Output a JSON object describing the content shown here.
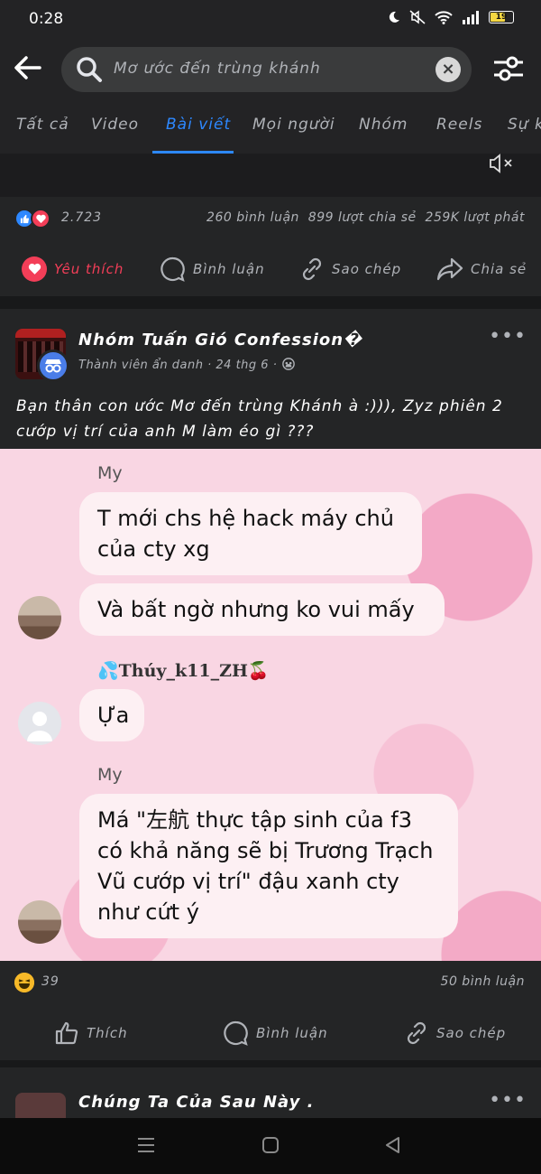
{
  "status": {
    "time": "0:28",
    "battery": "19"
  },
  "search": {
    "query": "Mơ ước đến trùng khánh"
  },
  "tabs": [
    "Tất cả",
    "Video",
    "Bài viết",
    "Mọi người",
    "Nhóm",
    "Reels",
    "Sự k"
  ],
  "active_tab": "Bài viết",
  "prev_post": {
    "reaction_count": "2.723",
    "comments": "260 bình luận",
    "shares": "899 lượt chia sẻ",
    "plays": "259K lượt phát",
    "actions": {
      "like": "Yêu thích",
      "comment": "Bình luận",
      "copy": "Sao chép",
      "share": "Chia sẻ"
    }
  },
  "post": {
    "group": "Nhóm Tuấn Gió Confession�",
    "author": "Thành viên ẩn danh",
    "date": "24 thg 6",
    "meta_sep": "·",
    "text": "Bạn thân con ước Mơ đến trùng Khánh à :))), Zyz phiên 2 cướp vị trí của anh M làm éo gì ???",
    "chat": {
      "sender1": "My",
      "msg1": "T mới chs hệ hack máy chủ của cty xg",
      "msg2": "Và bất ngờ nhưng ko vui mấy",
      "sender2": "💦Thúy_k11_ZH🍒",
      "msg3": "Ựa",
      "sender3": "My",
      "msg4": "Má \"左航 thực tập sinh của f3 có khả năng sẽ bị Trương Trạch Vũ cướp vị trí\" đậu xanh cty như cứt ý"
    },
    "reaction_count": "39",
    "comments": "50 bình luận",
    "actions": {
      "like": "Thích",
      "comment": "Bình luận",
      "copy": "Sao chép"
    }
  },
  "next_post": {
    "title": "Chúng Ta Của Sau Này ."
  },
  "colors": {
    "accent": "#2d88ff",
    "love": "#f33e58",
    "bg": "#242526"
  }
}
